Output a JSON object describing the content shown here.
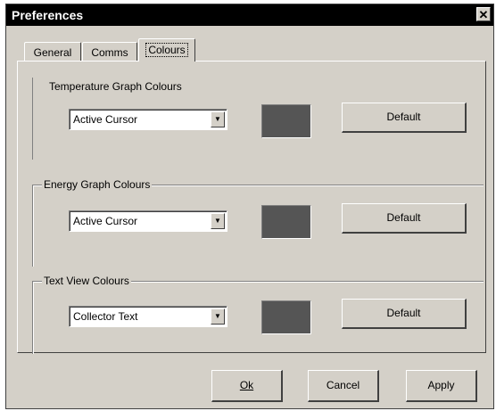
{
  "window": {
    "title": "Preferences",
    "close_glyph": "✕"
  },
  "tabs": [
    {
      "label": "General"
    },
    {
      "label": "Comms"
    },
    {
      "label": "Colours",
      "active": true
    }
  ],
  "groups": [
    {
      "label": "Temperature Graph Colours",
      "selected": "Active Cursor",
      "swatch_color": "#555555",
      "button_label": "Default"
    },
    {
      "label": "Energy Graph Colours",
      "selected": "Active Cursor",
      "swatch_color": "#555555",
      "button_label": "Default"
    },
    {
      "label": "Text View Colours",
      "selected": "Collector Text",
      "swatch_color": "#555555",
      "button_label": "Default"
    }
  ],
  "buttons": {
    "ok": "Ok",
    "cancel": "Cancel",
    "apply": "Apply"
  },
  "icons": {
    "dropdown_arrow": "▼"
  }
}
